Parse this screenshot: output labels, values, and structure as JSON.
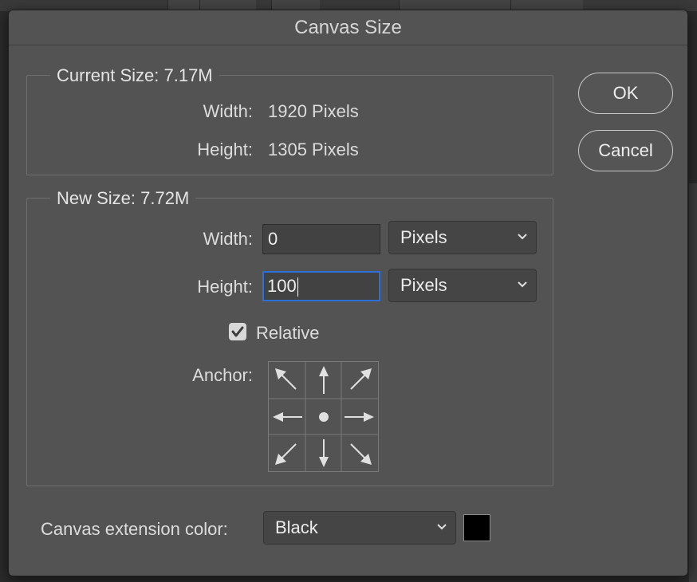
{
  "dialog": {
    "title": "Canvas Size"
  },
  "current_size": {
    "legend": "Current Size: 7.17M",
    "width_label": "Width:",
    "width_value": "1920 Pixels",
    "height_label": "Height:",
    "height_value": "1305 Pixels"
  },
  "new_size": {
    "legend": "New Size: 7.72M",
    "width_label": "Width:",
    "width_value": "0",
    "width_unit": "Pixels",
    "height_label": "Height:",
    "height_value": "100",
    "height_unit": "Pixels",
    "relative_label": "Relative",
    "relative_checked": true,
    "anchor_label": "Anchor:",
    "anchor_icons": [
      "arrow-up-left-icon",
      "arrow-up-icon",
      "arrow-up-right-icon",
      "arrow-left-icon",
      "anchor-center-dot-icon",
      "arrow-right-icon",
      "arrow-down-left-icon",
      "arrow-down-icon",
      "arrow-down-right-icon"
    ]
  },
  "extension": {
    "label": "Canvas extension color:",
    "value": "Black",
    "swatch_color": "#000000"
  },
  "buttons": {
    "ok": "OK",
    "cancel": "Cancel"
  },
  "colors": {
    "dialog_bg": "#535353",
    "focus_border": "#2d6fd8"
  }
}
